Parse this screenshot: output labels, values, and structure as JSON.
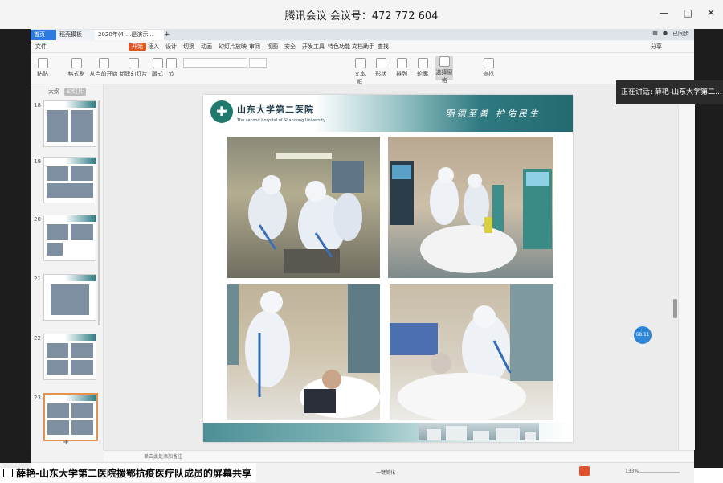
{
  "meeting": {
    "title": "腾讯会议 会议号：472 772 604",
    "speaking_label": "正在讲话: 薛艳-山东大学第二...",
    "share_caption": "薛艳-山东大学第二医院援鄂抗疫医疗队成员的屏幕共享"
  },
  "app": {
    "tabs": [
      "首页",
      "稻壳模板",
      "2020年(4)...是演示...",
      "+"
    ],
    "menu": [
      "文件",
      "开始",
      "插入",
      "设计",
      "切换",
      "动画",
      "幻灯片放映",
      "审阅",
      "视图",
      "安全",
      "开发工具",
      "特色功能",
      "文档助手",
      "查找"
    ],
    "active_menu": "开始",
    "ribbon": {
      "paste": "粘贴",
      "format_painter": "格式刷",
      "from_start": "从当前开始",
      "new_slide": "新建幻灯片",
      "layout": "版式",
      "section": "节",
      "reset": "重置",
      "textbox": "文本框",
      "shape": "形状",
      "arrange": "排列",
      "outline": "轮廓",
      "select": "选择窗格",
      "find": "查找"
    },
    "user": "已同步",
    "share": "分享",
    "thumb_view_tabs": [
      "大纲",
      "幻灯片"
    ],
    "thumb_numbers": [
      "18",
      "19",
      "20",
      "21",
      "22",
      "23"
    ],
    "notes_placeholder": "单击此处添加备注",
    "status_smooth": "一键美化",
    "zoom": "133%",
    "float_btn": "68.11"
  },
  "slide": {
    "university_cn": "山东大学第二医院",
    "university_en": "The second hospital of Shandong University",
    "motto": "明德至善 护佑民生"
  }
}
